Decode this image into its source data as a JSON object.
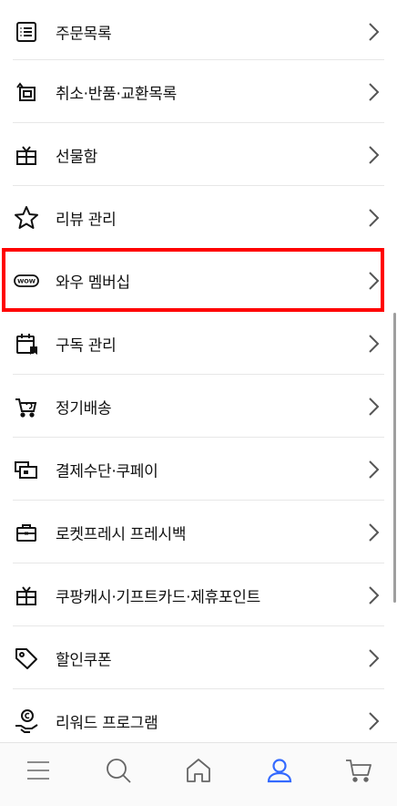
{
  "menu": {
    "items": [
      {
        "label": "주문목록",
        "icon": "order-list-icon"
      },
      {
        "label": "취소·반품·교환목록",
        "icon": "return-icon"
      },
      {
        "label": "선물함",
        "icon": "gift-box-icon"
      },
      {
        "label": "리뷰 관리",
        "icon": "star-icon"
      },
      {
        "label": "와우 멤버십",
        "icon": "wow-badge-icon",
        "badge_text": "WOW"
      },
      {
        "label": "구독 관리",
        "icon": "subscription-calendar-icon"
      },
      {
        "label": "정기배송",
        "icon": "recurring-cart-icon"
      },
      {
        "label": "결제수단·쿠페이",
        "icon": "payment-card-icon"
      },
      {
        "label": "로켓프레시 프레시백",
        "icon": "fresh-bag-icon"
      },
      {
        "label": "쿠팡캐시·기프트카드·제휴포인트",
        "icon": "gift-card-icon"
      },
      {
        "label": "할인쿠폰",
        "icon": "coupon-tag-icon"
      },
      {
        "label": "리워드 프로그램",
        "icon": "reward-coin-icon"
      }
    ]
  },
  "bottom_nav": {
    "items": [
      {
        "icon": "menu-icon"
      },
      {
        "icon": "search-icon"
      },
      {
        "icon": "home-icon"
      },
      {
        "icon": "profile-icon",
        "active": true
      },
      {
        "icon": "cart-icon"
      }
    ]
  },
  "colors": {
    "highlight": "#ff0000",
    "active_nav": "#346aff",
    "icon": "#111111",
    "chevron": "#555555",
    "divider": "#e7e7e7"
  }
}
